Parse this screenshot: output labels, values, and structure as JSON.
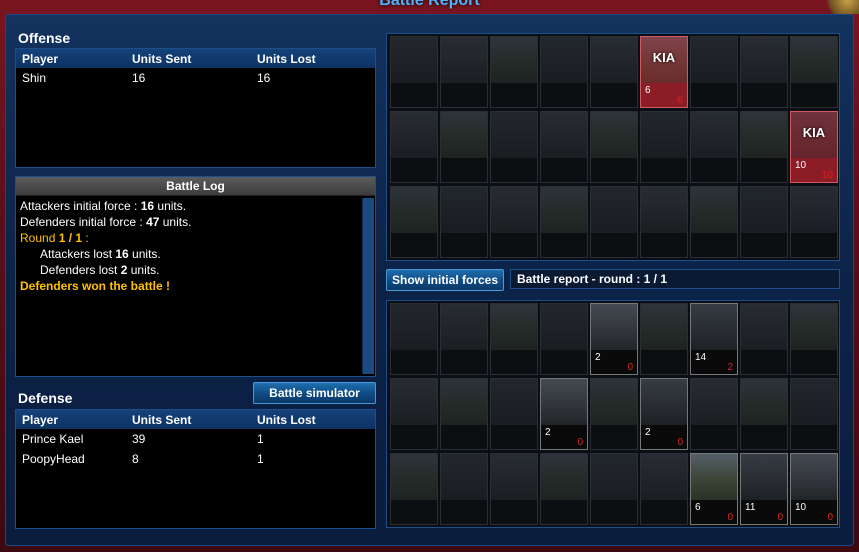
{
  "window": {
    "title": "Battle Report"
  },
  "offense": {
    "title": "Offense",
    "columns": [
      "Player",
      "Units Sent",
      "Units Lost"
    ],
    "rows": [
      {
        "player": "Shin",
        "sent": "16",
        "lost": "16"
      }
    ]
  },
  "battle_log": {
    "title": "Battle Log",
    "line1_pre": "Attackers initial force : ",
    "line1_num": "16",
    "line1_post": " units.",
    "line2_pre": "Defenders initial force : ",
    "line2_num": "47",
    "line2_post": " units.",
    "round_pre": "Round ",
    "round_num": "1 / 1",
    "round_post": " :",
    "att_lost_pre": "Attackers lost ",
    "att_lost_num": "16",
    "att_lost_post": " units.",
    "def_lost_pre": "Defenders lost ",
    "def_lost_num": "2",
    "def_lost_post": " units.",
    "result": "Defenders won the battle !"
  },
  "defense": {
    "title": "Defense",
    "columns": [
      "Player",
      "Units Sent",
      "Units Lost"
    ],
    "rows": [
      {
        "player": "Prince Kael",
        "sent": "39",
        "lost": "1"
      },
      {
        "player": "PoopyHead",
        "sent": "8",
        "lost": "1"
      }
    ]
  },
  "buttons": {
    "battle_simulator": "Battle simulator",
    "show_initial_forces": "Show initial forces"
  },
  "report_label": "Battle report - round : 1 / 1",
  "attacker_grid": {
    "kia_label": "KIA",
    "cells": [
      {
        "state": "dim"
      },
      {
        "state": "dim"
      },
      {
        "state": "dim"
      },
      {
        "state": "dim"
      },
      {
        "state": "dim"
      },
      {
        "state": "kia",
        "count": "6",
        "lost": "6"
      },
      {
        "state": "dim"
      },
      {
        "state": "dim"
      },
      {
        "state": "dim"
      },
      {
        "state": "dim"
      },
      {
        "state": "dim"
      },
      {
        "state": "dim"
      },
      {
        "state": "dim"
      },
      {
        "state": "dim"
      },
      {
        "state": "dim"
      },
      {
        "state": "dim"
      },
      {
        "state": "dim"
      },
      {
        "state": "kia",
        "count": "10",
        "lost": "10"
      },
      {
        "state": "dim"
      },
      {
        "state": "dim"
      },
      {
        "state": "dim"
      },
      {
        "state": "dim"
      },
      {
        "state": "dim"
      },
      {
        "state": "dim"
      },
      {
        "state": "dim"
      },
      {
        "state": "dim"
      },
      {
        "state": "dim"
      }
    ]
  },
  "defender_grid": {
    "cells": [
      {
        "state": "dim"
      },
      {
        "state": "dim"
      },
      {
        "state": "dim"
      },
      {
        "state": "dim"
      },
      {
        "state": "active",
        "count": "2",
        "lost": "0"
      },
      {
        "state": "dim"
      },
      {
        "state": "active",
        "count": "14",
        "lost": "2"
      },
      {
        "state": "dim"
      },
      {
        "state": "dim"
      },
      {
        "state": "dim"
      },
      {
        "state": "dim"
      },
      {
        "state": "dim"
      },
      {
        "state": "active",
        "count": "2",
        "lost": "0"
      },
      {
        "state": "dim"
      },
      {
        "state": "active",
        "count": "2",
        "lost": "0"
      },
      {
        "state": "dim"
      },
      {
        "state": "dim"
      },
      {
        "state": "dim"
      },
      {
        "state": "dim"
      },
      {
        "state": "dim"
      },
      {
        "state": "dim"
      },
      {
        "state": "dim"
      },
      {
        "state": "dim"
      },
      {
        "state": "dim"
      },
      {
        "state": "active",
        "count": "6",
        "lost": "0"
      },
      {
        "state": "active",
        "count": "11",
        "lost": "0"
      },
      {
        "state": "active",
        "count": "10",
        "lost": "0"
      }
    ]
  },
  "colors": {
    "accent": "#4cb3ff",
    "gold": "#ffc000",
    "lost_red": "#e02020",
    "kia_red": "#9c2630"
  }
}
